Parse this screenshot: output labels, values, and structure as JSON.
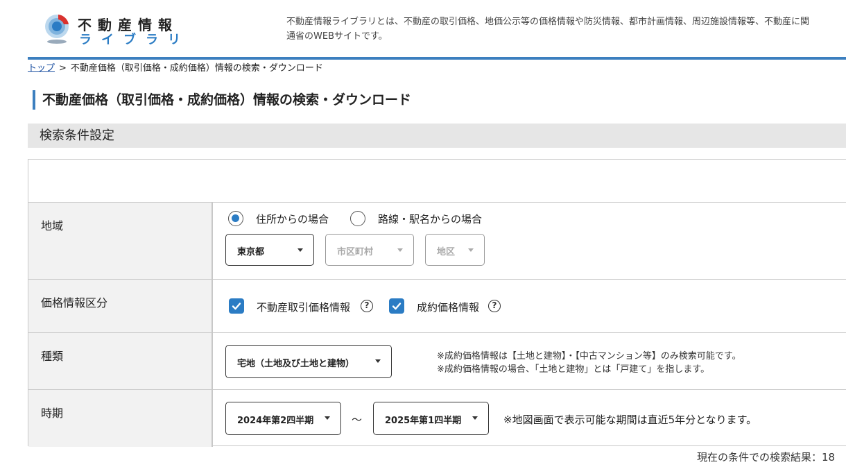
{
  "header": {
    "logo_top": "不動産情報",
    "logo_bottom": "ライブラリ",
    "description_line1": "不動産情報ライブラリとは、不動産の取引価格、地価公示等の価格情報や防災情報、都市計画情報、周辺施設情報等、不動産に関",
    "description_line2": "通省のWEBサイトです。"
  },
  "breadcrumb": {
    "home": "トップ",
    "separator": ">",
    "current": "不動産価格（取引価格・成約価格）情報の検索・ダウンロード"
  },
  "page_title": "不動産価格（取引価格・成約価格）情報の検索・ダウンロード",
  "section_title": "検索条件設定",
  "rows": {
    "region": {
      "label": "地域",
      "radio_address": "住所からの場合",
      "radio_station": "路線・駅名からの場合",
      "prefecture": "東京都",
      "city": "市区町村",
      "district": "地区"
    },
    "price_type": {
      "label": "価格情報区分",
      "option1": "不動産取引価格情報",
      "option2": "成約価格情報",
      "help_glyph": "?"
    },
    "kind": {
      "label": "種類",
      "value": "宅地（土地及び土地と建物）",
      "note1": "※成約価格情報は【土地と建物】・【中古マンション等】のみ検索可能です。",
      "note2": "※成約価格情報の場合、「土地と建物」とは「戸建て」を指します。"
    },
    "period": {
      "label": "時期",
      "from": "2024年第2四半期",
      "tilde": "～",
      "to": "2025年第1四半期",
      "note": "※地図画面で表示可能な期間は直近5年分となります。"
    }
  },
  "result_text": "現在の条件での検索結果：18",
  "colors": {
    "accent": "#3c7fbf",
    "checkbox": "#2b7cc4",
    "section_bg": "#e6e6e6",
    "label_bg": "#f2f2f2"
  }
}
